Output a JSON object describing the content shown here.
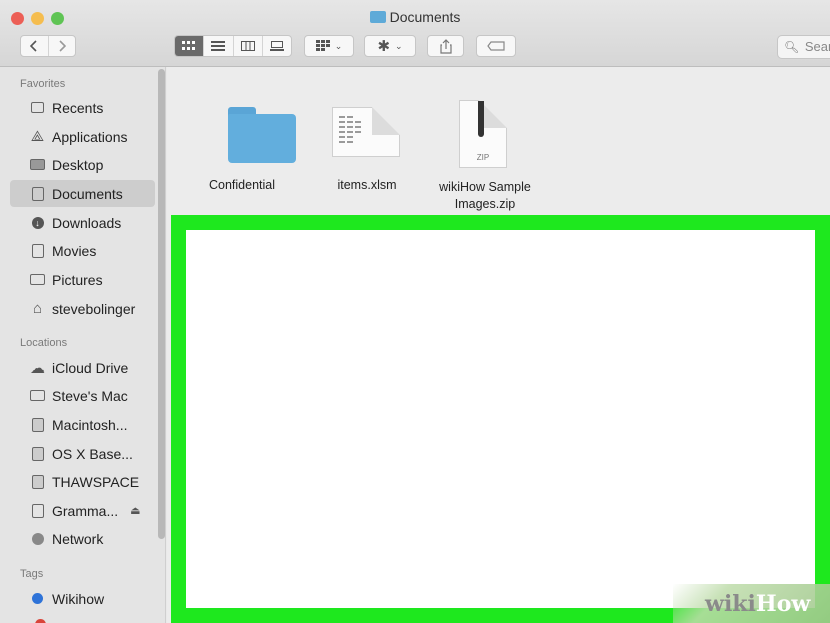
{
  "window": {
    "title": "Documents",
    "traffic_lights": {
      "close": "#ec5f56",
      "minimize": "#f5bd4f",
      "zoom": "#5fc454"
    }
  },
  "toolbar": {
    "back_icon": "chevron-left-icon",
    "forward_icon": "chevron-right-icon",
    "view_modes": [
      "icon-view",
      "list-view",
      "column-view",
      "gallery-view"
    ],
    "group_icon": "group-grid-icon",
    "action_icon": "gear-icon",
    "share_icon": "share-icon",
    "tag_icon": "tag-icon",
    "search_placeholder": "Sear"
  },
  "sidebar": {
    "favorites_label": "Favorites",
    "favorites": [
      {
        "label": "Recents",
        "icon": "clock-icon"
      },
      {
        "label": "Applications",
        "icon": "applications-icon"
      },
      {
        "label": "Desktop",
        "icon": "desktop-icon"
      },
      {
        "label": "Documents",
        "icon": "document-icon",
        "selected": true
      },
      {
        "label": "Downloads",
        "icon": "download-icon"
      },
      {
        "label": "Movies",
        "icon": "film-icon"
      },
      {
        "label": "Pictures",
        "icon": "camera-icon"
      },
      {
        "label": "stevebolinger",
        "icon": "home-icon"
      }
    ],
    "locations_label": "Locations",
    "locations": [
      {
        "label": "iCloud Drive",
        "icon": "cloud-icon"
      },
      {
        "label": "Steve's Mac",
        "icon": "computer-icon"
      },
      {
        "label": "Macintosh...",
        "icon": "disk-icon"
      },
      {
        "label": "OS X Base...",
        "icon": "disk-icon"
      },
      {
        "label": "THAWSPACE",
        "icon": "disk-icon"
      },
      {
        "label": "Gramma...",
        "icon": "disk-icon",
        "eject": "⏏"
      },
      {
        "label": "Network",
        "icon": "globe-icon"
      }
    ],
    "tags_label": "Tags",
    "tags": [
      {
        "label": "Wikihow",
        "color": "#2e73d8"
      }
    ]
  },
  "files": [
    {
      "name": "Confidential",
      "icon": "folder-icon"
    },
    {
      "name": "items.xlsm",
      "icon": "spreadsheet-icon"
    },
    {
      "name_line1": "wikiHow Sample",
      "name_line2": "Images.zip",
      "icon": "zip-icon",
      "badge": "ZIP"
    }
  ],
  "highlight_color": "#1ee81e",
  "watermark": {
    "part1": "wiki",
    "part2": "How"
  }
}
